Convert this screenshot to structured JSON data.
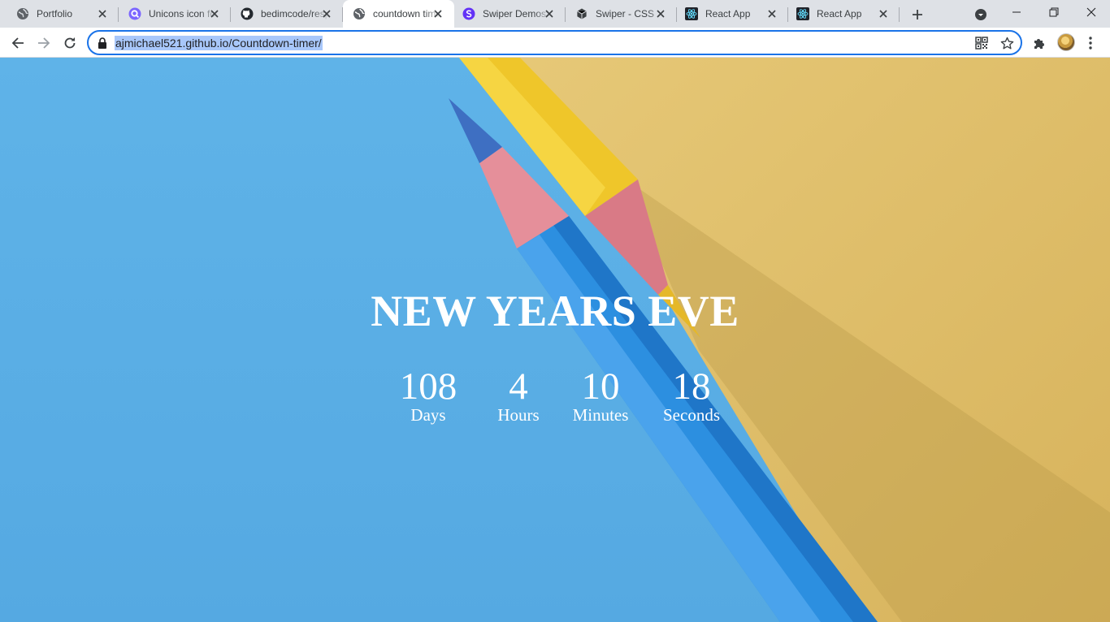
{
  "browser": {
    "tabs": [
      {
        "title": "Portfolio",
        "icon": "globe-icon",
        "active": false
      },
      {
        "title": "Unicons icon fonts",
        "icon": "unicons-icon",
        "active": false
      },
      {
        "title": "bedimcode/responsive",
        "icon": "github-icon",
        "active": false
      },
      {
        "title": "countdown timer",
        "icon": "globe-icon",
        "active": true
      },
      {
        "title": "Swiper Demos",
        "icon": "swiper-icon",
        "active": false
      },
      {
        "title": "Swiper - CSS",
        "icon": "codesandbox-icon",
        "active": false
      },
      {
        "title": "React App",
        "icon": "react-icon",
        "active": false
      },
      {
        "title": "React App",
        "icon": "react-icon",
        "active": false
      }
    ],
    "address": {
      "url": "ajmichael521.github.io/Countdown-timer/"
    },
    "colors": {
      "tabstrip": "#dee1e6",
      "focus_ring": "#1a73e8",
      "url_highlight": "#a8c7fa"
    }
  },
  "page": {
    "heading": "NEW YEARS EVE",
    "countdown": [
      {
        "value": "108",
        "label": "Days"
      },
      {
        "value": "4",
        "label": "Hours"
      },
      {
        "value": "10",
        "label": "Minutes"
      },
      {
        "value": "18",
        "label": "Seconds"
      }
    ],
    "colors": {
      "paper_blue": "#5db1e6",
      "paper_yellow": "#e0c06e",
      "text": "#ffffff"
    }
  }
}
